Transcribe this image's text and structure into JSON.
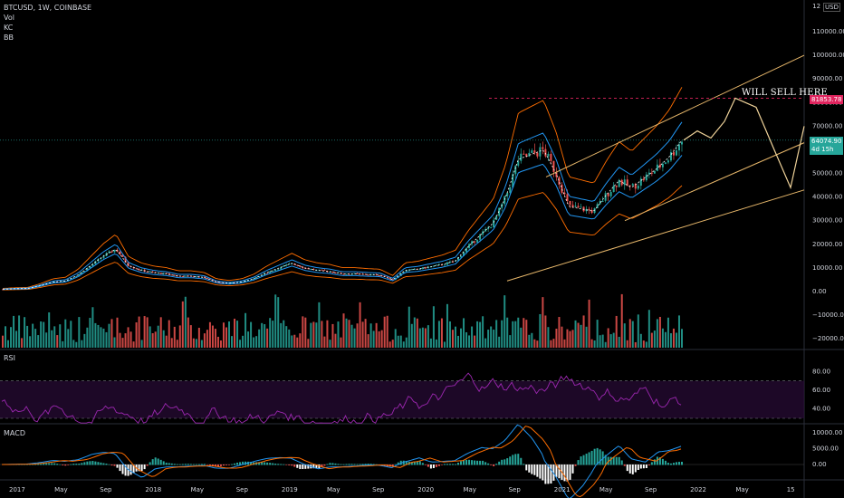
{
  "header": {
    "symbol": "BTCUSD, 1W, COINBASE",
    "indicators": [
      "Vol",
      "KC",
      "BB"
    ]
  },
  "currency": {
    "top_label": "12",
    "unit": "USD"
  },
  "price_axis": {
    "ticks": [
      "110000.00",
      "100000.00",
      "90000.00",
      "80000.00",
      "70000.00",
      "60000.00",
      "50000.00",
      "40000.00",
      "30000.00",
      "20000.00",
      "10000.00",
      "0.00",
      "−10000.00",
      "−20000.00"
    ]
  },
  "badges": {
    "target_price": "81853.78",
    "last_price": "64074.90",
    "countdown": "4d 15h"
  },
  "annotation": "WILL SELL HERE",
  "rsi": {
    "title": "RSI",
    "ticks": [
      "80.00",
      "60.00",
      "40.00"
    ]
  },
  "macd": {
    "title": "MACD",
    "ticks": [
      "10000.00",
      "5000.00",
      "0.00"
    ]
  },
  "time_axis": [
    "2017",
    "May",
    "Sep",
    "2018",
    "May",
    "Sep",
    "2019",
    "May",
    "Sep",
    "2020",
    "May",
    "Sep",
    "2021",
    "May",
    "Sep",
    "2022",
    "May",
    "15"
  ],
  "colors": {
    "background": "#000000",
    "up": "#26a69a",
    "down": "#ef5350",
    "trendline": "#e8b86b",
    "kc_mid": "#2196f3",
    "bb_upper": "#ff6d00",
    "rsi": "#9c27b0",
    "target": "#e0245e",
    "last": "#26a69a"
  },
  "chart_data": {
    "type": "candlestick",
    "timeframe": "1W",
    "x_range": [
      "2017-01",
      "2022-10"
    ],
    "ylim": [
      -22000,
      120000
    ],
    "weekly_close_approx": [
      1000,
      1200,
      1300,
      2500,
      4000,
      4500,
      7000,
      11000,
      15000,
      18000,
      11000,
      9000,
      8000,
      7500,
      6500,
      6500,
      6000,
      4000,
      3500,
      4000,
      5500,
      8000,
      10000,
      12000,
      10000,
      9000,
      8500,
      7500,
      7500,
      7200,
      7000,
      5000,
      9000,
      9500,
      10500,
      11500,
      13000,
      19000,
      24000,
      29000,
      40000,
      56000,
      58000,
      60000,
      50000,
      36000,
      35000,
      34000,
      41000,
      47000,
      44000,
      48000,
      52000,
      57000,
      64075
    ],
    "projection_path": [
      64075,
      68000,
      65000,
      72000,
      81853,
      78000,
      60000,
      44000,
      70000
    ]
  }
}
